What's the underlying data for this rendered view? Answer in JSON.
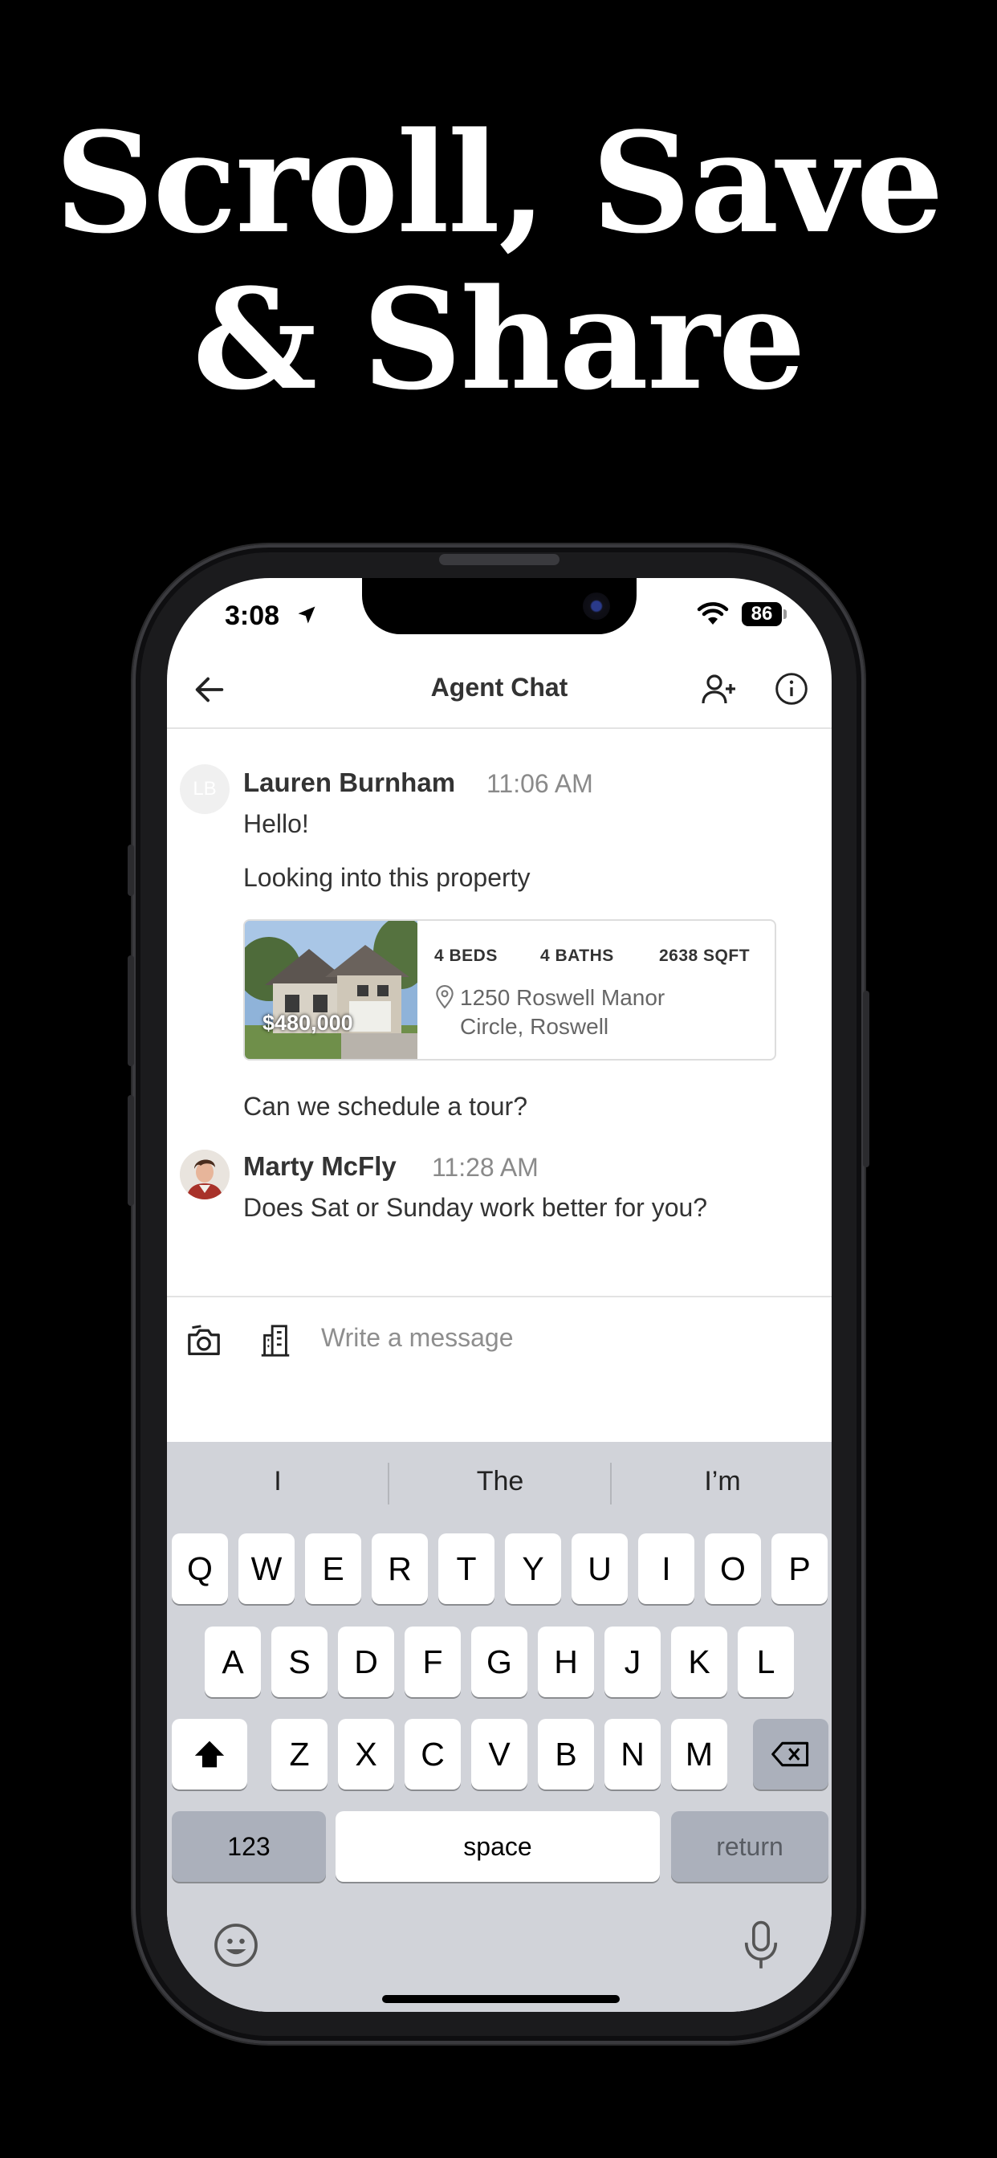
{
  "headline": {
    "line1": "Scroll, Save",
    "line2": "& Share"
  },
  "status_bar": {
    "time": "3:08",
    "battery": "86"
  },
  "nav": {
    "title": "Agent Chat"
  },
  "messages": [
    {
      "sender": "Lauren Burnham",
      "initials": "LB",
      "time": "11:06 AM",
      "lines": [
        "Hello!",
        "Looking into this property"
      ],
      "listing": {
        "price": "$480,000",
        "beds": "4 BEDS",
        "baths": "4 BATHS",
        "sqft": "2638 SQFT",
        "address_line1": "1250 Roswell Manor",
        "address_line2": "Circle, Roswell"
      },
      "after": "Can we schedule a tour?"
    },
    {
      "sender": "Marty McFly",
      "time": "11:28 AM",
      "lines": [
        "Does Sat or Sunday work better for you?"
      ]
    }
  ],
  "composer": {
    "placeholder": "Write a message"
  },
  "keyboard": {
    "suggestions": [
      "I",
      "The",
      "I’m"
    ],
    "row1": [
      "Q",
      "W",
      "E",
      "R",
      "T",
      "Y",
      "U",
      "I",
      "O",
      "P"
    ],
    "row2": [
      "A",
      "S",
      "D",
      "F",
      "G",
      "H",
      "J",
      "K",
      "L"
    ],
    "row3": [
      "Z",
      "X",
      "C",
      "V",
      "B",
      "N",
      "M"
    ],
    "numbers_key": "123",
    "space_key": "space",
    "return_key": "return"
  },
  "colors": {
    "background": "#000000",
    "keyboard": "#d1d3d9",
    "text": "#333333",
    "muted": "#8a8a8a"
  }
}
